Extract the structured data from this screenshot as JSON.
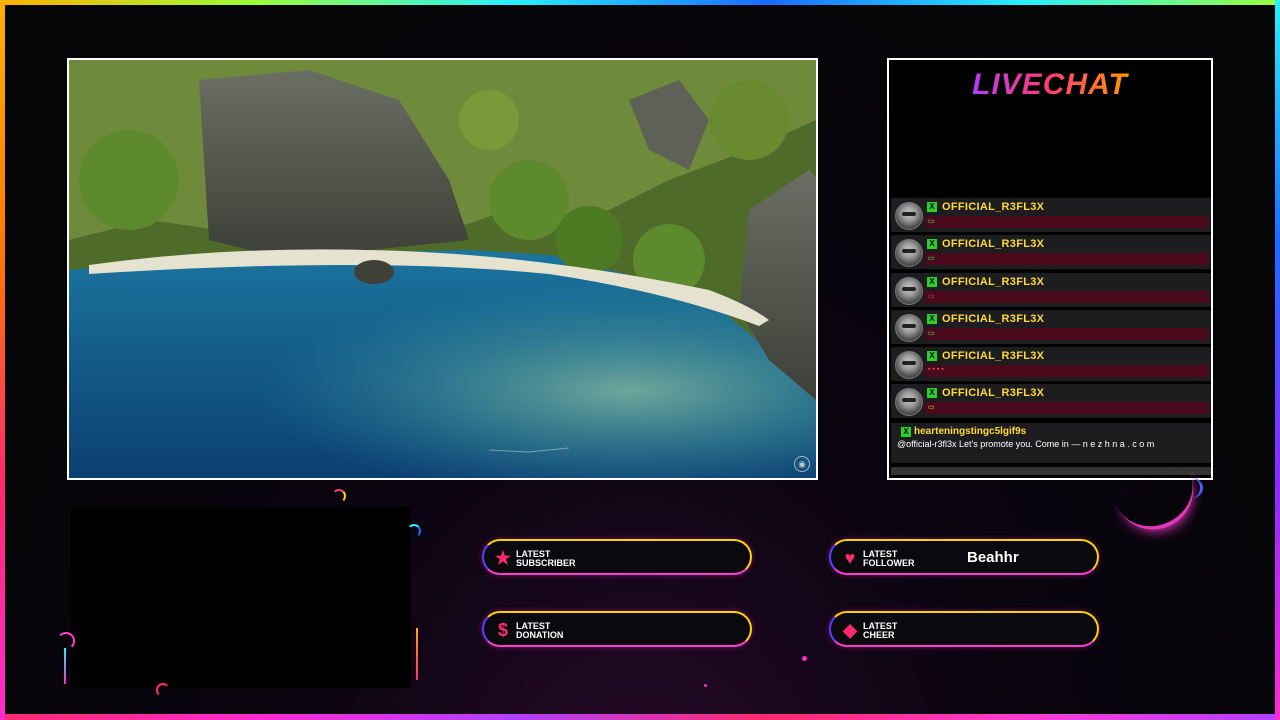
{
  "chat": {
    "title": "LIVECHAT",
    "messages": [
      {
        "user": "OFFICIAL_R3FL3X",
        "badge": "X",
        "emote": "▭"
      },
      {
        "user": "OFFICIAL_R3FL3X",
        "badge": "X",
        "emote": "▭"
      },
      {
        "user": "OFFICIAL_R3FL3X",
        "badge": "X",
        "emote": "▭"
      },
      {
        "user": "OFFICIAL_R3FL3X",
        "badge": "X",
        "emote": "▭"
      },
      {
        "user": "OFFICIAL_R3FL3X",
        "badge": "X",
        "emote": "▪ ▪ ▪ ▪"
      },
      {
        "user": "OFFICIAL_R3FL3X",
        "badge": "X",
        "emote": "▭"
      }
    ],
    "last_message": {
      "user": "hearteningstingc5lgif9s",
      "badge": "X",
      "text": "@official-r3fl3x Let's promote you. Come in — n e z h n a . c o m"
    }
  },
  "widgets": {
    "subscriber": {
      "icon": "star-icon",
      "glyph": "★",
      "label1": "LATEST",
      "label2": "SUBSCRIBER",
      "value": ""
    },
    "follower": {
      "icon": "heart-icon",
      "glyph": "♥",
      "label1": "LATEST",
      "label2": "FOLLOWER",
      "value": "Beahhr"
    },
    "donation": {
      "icon": "dollar-icon",
      "glyph": "$",
      "label1": "LATEST",
      "label2": "DONATION",
      "value": ""
    },
    "cheer": {
      "icon": "diamond-icon",
      "glyph": "◆",
      "label1": "LATEST",
      "label2": "CHEER",
      "value": ""
    }
  },
  "camera": {
    "icon": "camera-settings-icon",
    "glyph": "◉"
  },
  "colors": {
    "accent_pink": "#ff2a6d",
    "accent_yellow": "#ffd83a",
    "badge_green": "#2ad12a"
  }
}
